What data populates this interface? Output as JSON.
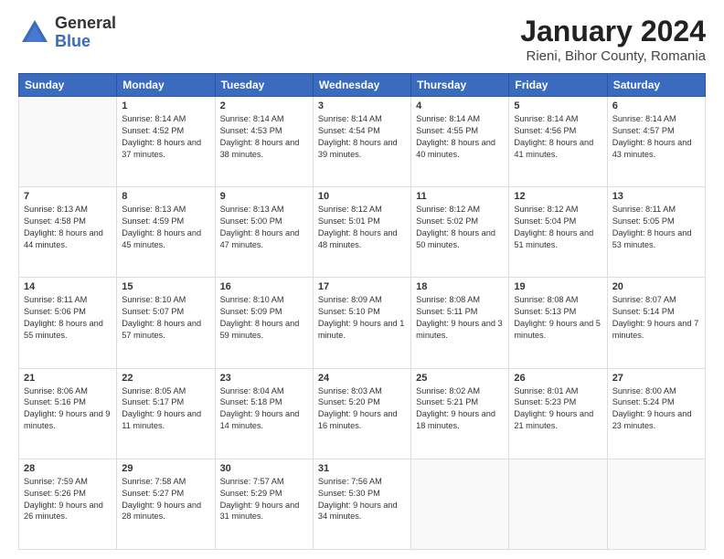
{
  "header": {
    "logo_general": "General",
    "logo_blue": "Blue",
    "month_title": "January 2024",
    "location": "Rieni, Bihor County, Romania"
  },
  "weekdays": [
    "Sunday",
    "Monday",
    "Tuesday",
    "Wednesday",
    "Thursday",
    "Friday",
    "Saturday"
  ],
  "weeks": [
    [
      {
        "day": "",
        "sunrise": "",
        "sunset": "",
        "daylight": ""
      },
      {
        "day": "1",
        "sunrise": "Sunrise: 8:14 AM",
        "sunset": "Sunset: 4:52 PM",
        "daylight": "Daylight: 8 hours and 37 minutes."
      },
      {
        "day": "2",
        "sunrise": "Sunrise: 8:14 AM",
        "sunset": "Sunset: 4:53 PM",
        "daylight": "Daylight: 8 hours and 38 minutes."
      },
      {
        "day": "3",
        "sunrise": "Sunrise: 8:14 AM",
        "sunset": "Sunset: 4:54 PM",
        "daylight": "Daylight: 8 hours and 39 minutes."
      },
      {
        "day": "4",
        "sunrise": "Sunrise: 8:14 AM",
        "sunset": "Sunset: 4:55 PM",
        "daylight": "Daylight: 8 hours and 40 minutes."
      },
      {
        "day": "5",
        "sunrise": "Sunrise: 8:14 AM",
        "sunset": "Sunset: 4:56 PM",
        "daylight": "Daylight: 8 hours and 41 minutes."
      },
      {
        "day": "6",
        "sunrise": "Sunrise: 8:14 AM",
        "sunset": "Sunset: 4:57 PM",
        "daylight": "Daylight: 8 hours and 43 minutes."
      }
    ],
    [
      {
        "day": "7",
        "sunrise": "Sunrise: 8:13 AM",
        "sunset": "Sunset: 4:58 PM",
        "daylight": "Daylight: 8 hours and 44 minutes."
      },
      {
        "day": "8",
        "sunrise": "Sunrise: 8:13 AM",
        "sunset": "Sunset: 4:59 PM",
        "daylight": "Daylight: 8 hours and 45 minutes."
      },
      {
        "day": "9",
        "sunrise": "Sunrise: 8:13 AM",
        "sunset": "Sunset: 5:00 PM",
        "daylight": "Daylight: 8 hours and 47 minutes."
      },
      {
        "day": "10",
        "sunrise": "Sunrise: 8:12 AM",
        "sunset": "Sunset: 5:01 PM",
        "daylight": "Daylight: 8 hours and 48 minutes."
      },
      {
        "day": "11",
        "sunrise": "Sunrise: 8:12 AM",
        "sunset": "Sunset: 5:02 PM",
        "daylight": "Daylight: 8 hours and 50 minutes."
      },
      {
        "day": "12",
        "sunrise": "Sunrise: 8:12 AM",
        "sunset": "Sunset: 5:04 PM",
        "daylight": "Daylight: 8 hours and 51 minutes."
      },
      {
        "day": "13",
        "sunrise": "Sunrise: 8:11 AM",
        "sunset": "Sunset: 5:05 PM",
        "daylight": "Daylight: 8 hours and 53 minutes."
      }
    ],
    [
      {
        "day": "14",
        "sunrise": "Sunrise: 8:11 AM",
        "sunset": "Sunset: 5:06 PM",
        "daylight": "Daylight: 8 hours and 55 minutes."
      },
      {
        "day": "15",
        "sunrise": "Sunrise: 8:10 AM",
        "sunset": "Sunset: 5:07 PM",
        "daylight": "Daylight: 8 hours and 57 minutes."
      },
      {
        "day": "16",
        "sunrise": "Sunrise: 8:10 AM",
        "sunset": "Sunset: 5:09 PM",
        "daylight": "Daylight: 8 hours and 59 minutes."
      },
      {
        "day": "17",
        "sunrise": "Sunrise: 8:09 AM",
        "sunset": "Sunset: 5:10 PM",
        "daylight": "Daylight: 9 hours and 1 minute."
      },
      {
        "day": "18",
        "sunrise": "Sunrise: 8:08 AM",
        "sunset": "Sunset: 5:11 PM",
        "daylight": "Daylight: 9 hours and 3 minutes."
      },
      {
        "day": "19",
        "sunrise": "Sunrise: 8:08 AM",
        "sunset": "Sunset: 5:13 PM",
        "daylight": "Daylight: 9 hours and 5 minutes."
      },
      {
        "day": "20",
        "sunrise": "Sunrise: 8:07 AM",
        "sunset": "Sunset: 5:14 PM",
        "daylight": "Daylight: 9 hours and 7 minutes."
      }
    ],
    [
      {
        "day": "21",
        "sunrise": "Sunrise: 8:06 AM",
        "sunset": "Sunset: 5:16 PM",
        "daylight": "Daylight: 9 hours and 9 minutes."
      },
      {
        "day": "22",
        "sunrise": "Sunrise: 8:05 AM",
        "sunset": "Sunset: 5:17 PM",
        "daylight": "Daylight: 9 hours and 11 minutes."
      },
      {
        "day": "23",
        "sunrise": "Sunrise: 8:04 AM",
        "sunset": "Sunset: 5:18 PM",
        "daylight": "Daylight: 9 hours and 14 minutes."
      },
      {
        "day": "24",
        "sunrise": "Sunrise: 8:03 AM",
        "sunset": "Sunset: 5:20 PM",
        "daylight": "Daylight: 9 hours and 16 minutes."
      },
      {
        "day": "25",
        "sunrise": "Sunrise: 8:02 AM",
        "sunset": "Sunset: 5:21 PM",
        "daylight": "Daylight: 9 hours and 18 minutes."
      },
      {
        "day": "26",
        "sunrise": "Sunrise: 8:01 AM",
        "sunset": "Sunset: 5:23 PM",
        "daylight": "Daylight: 9 hours and 21 minutes."
      },
      {
        "day": "27",
        "sunrise": "Sunrise: 8:00 AM",
        "sunset": "Sunset: 5:24 PM",
        "daylight": "Daylight: 9 hours and 23 minutes."
      }
    ],
    [
      {
        "day": "28",
        "sunrise": "Sunrise: 7:59 AM",
        "sunset": "Sunset: 5:26 PM",
        "daylight": "Daylight: 9 hours and 26 minutes."
      },
      {
        "day": "29",
        "sunrise": "Sunrise: 7:58 AM",
        "sunset": "Sunset: 5:27 PM",
        "daylight": "Daylight: 9 hours and 28 minutes."
      },
      {
        "day": "30",
        "sunrise": "Sunrise: 7:57 AM",
        "sunset": "Sunset: 5:29 PM",
        "daylight": "Daylight: 9 hours and 31 minutes."
      },
      {
        "day": "31",
        "sunrise": "Sunrise: 7:56 AM",
        "sunset": "Sunset: 5:30 PM",
        "daylight": "Daylight: 9 hours and 34 minutes."
      },
      {
        "day": "",
        "sunrise": "",
        "sunset": "",
        "daylight": ""
      },
      {
        "day": "",
        "sunrise": "",
        "sunset": "",
        "daylight": ""
      },
      {
        "day": "",
        "sunrise": "",
        "sunset": "",
        "daylight": ""
      }
    ]
  ]
}
